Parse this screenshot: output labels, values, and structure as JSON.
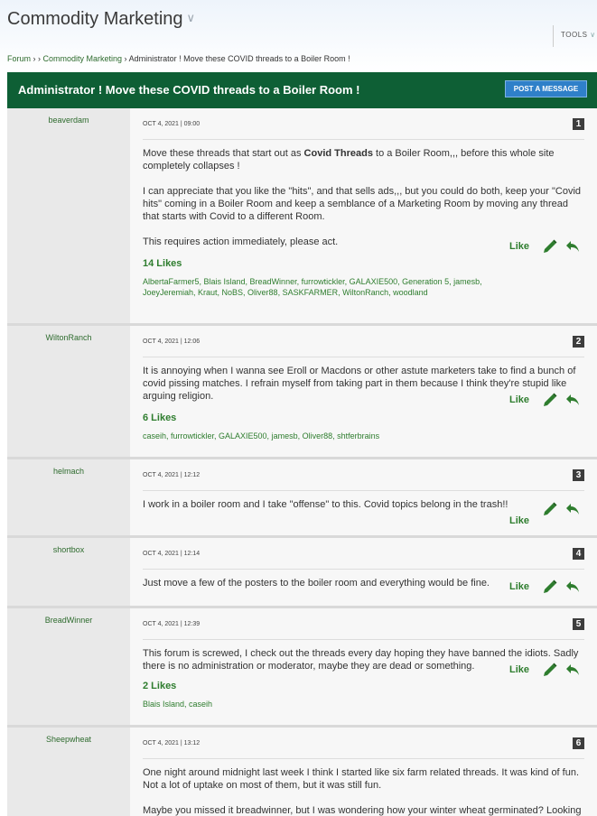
{
  "header": {
    "forum_title": "Commodity Marketing",
    "tools": "TOOLS"
  },
  "breadcrumb": {
    "forum": "Forum",
    "sep1": " › › ",
    "section": "Commodity Marketing",
    "sep2": " › ",
    "current": "Administrator ! Move these COVID threads to a Boiler Room !"
  },
  "thread": {
    "title": "Administrator ! Move these COVID threads to a Boiler Room !",
    "post_button": "POST A MESSAGE"
  },
  "posts": [
    {
      "author": "beaverdam",
      "date": "OCT 4, 2021 | 09:00",
      "number": "1",
      "paragraphs": [
        "Move these threads that start out as ",
        "Covid Threads",
        " to a Boiler Room,,, before this whole site completely collapses !",
        "I can appreciate that you like the \"hits\", and that sells ads,,, but you could do both, keep your \"Covid hits\" coming in a Boiler Room and keep a semblance of a Marketing Room by moving any thread that starts with Covid to a different Room.",
        "This requires action immediately, please act."
      ],
      "like_label": "Like",
      "likes_count": "14 Likes",
      "likers": "AlbertaFarmer5, Blais Island, BreadWinner, furrowtickler, GALAXIE500, Generation 5, jamesb, JoeyJeremiah, Kraut, NoBS, Oliver88, SASKFARMER, WiltonRanch, woodland"
    },
    {
      "author": "WiltonRanch",
      "date": "OCT 4, 2021 | 12:06",
      "number": "2",
      "paragraphs": [
        "It is annoying when I wanna see Eroll or Macdons or other astute marketers take to find a bunch of covid pissing matches. I refrain myself from taking part in them because I think they're stupid like arguing religion."
      ],
      "like_label": "Like",
      "likes_count": "6 Likes",
      "likers": "caseih, furrowtickler, GALAXIE500, jamesb, Oliver88, shtferbrains"
    },
    {
      "author": "helmach",
      "date": "OCT 4, 2021 | 12:12",
      "number": "3",
      "paragraphs": [
        "I work in a boiler room and I take \"offense\" to this. Covid topics belong in the trash!!"
      ],
      "like_label": "Like"
    },
    {
      "author": "shortbox",
      "date": "OCT 4, 2021 | 12:14",
      "number": "4",
      "paragraphs": [
        "Just move a few of the posters to the boiler room and everything would be fine."
      ],
      "like_label": "Like"
    },
    {
      "author": "BreadWinner",
      "date": "OCT 4, 2021 | 12:39",
      "number": "5",
      "paragraphs": [
        "This forum is screwed, I check out the threads every day hoping they have banned the idiots. Sadly there is no administration or moderator, maybe they are dead or something."
      ],
      "like_label": "Like",
      "likes_count": "2 Likes",
      "likers": "Blais Island, caseih"
    },
    {
      "author": "Sheepwheat",
      "date": "OCT 4, 2021 | 13:12",
      "number": "6",
      "paragraphs": [
        "One night around midnight last week I think I started like six farm related threads. It was kind of fun. Not a lot of uptake on most of them, but it was still fun.",
        "Maybe you missed it breadwinner, but I was wondering how your winter wheat germinated? Looking"
      ]
    }
  ],
  "icons": {
    "edit": "pencil-icon",
    "reply": "reply-arrow-icon",
    "dropdown": "chevron-down-icon"
  },
  "colors": {
    "header_bg": "#0e5f35",
    "accent_green": "#2e7d2e",
    "button_blue": "#2f80c9"
  }
}
